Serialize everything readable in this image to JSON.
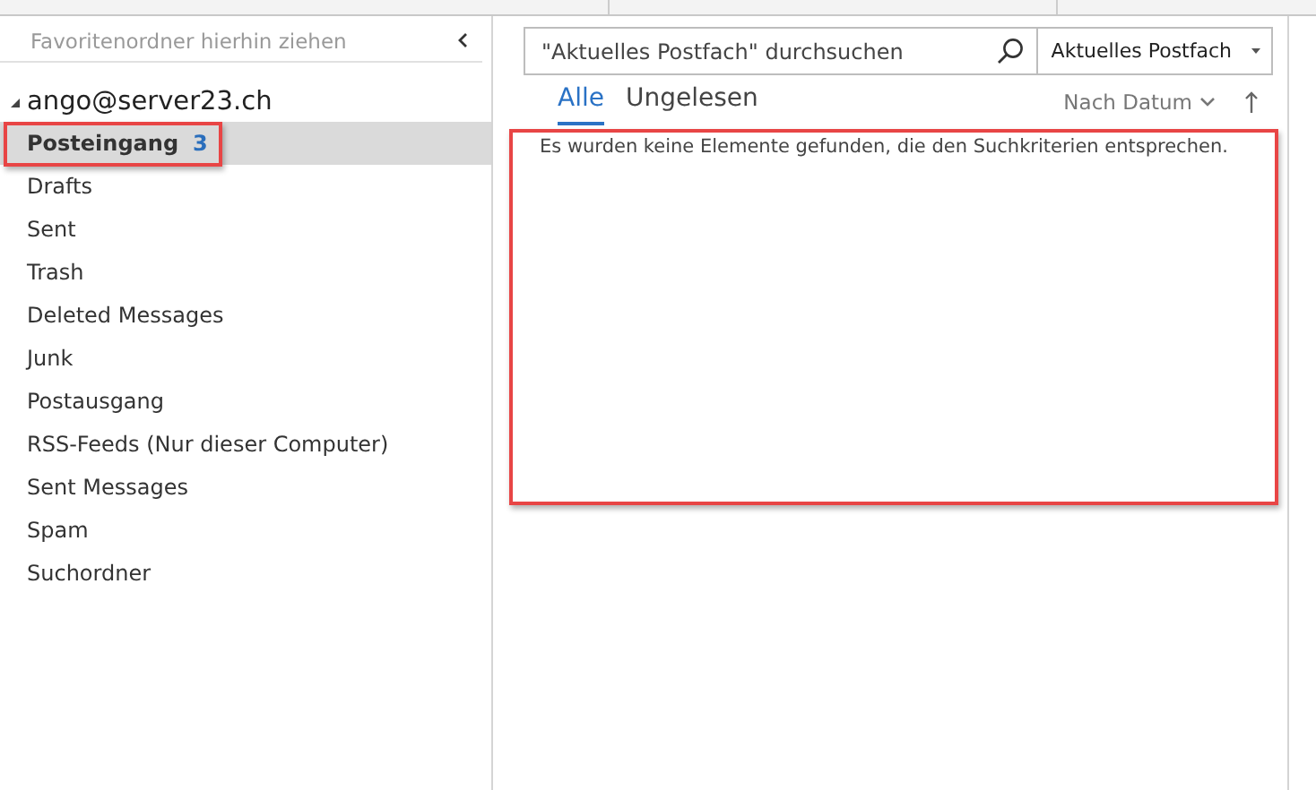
{
  "favorites": {
    "hint": "Favoritenordner hierhin ziehen"
  },
  "account": {
    "name": "ango@server23.ch",
    "expanded": true
  },
  "folders": [
    {
      "name": "Posteingang",
      "count": "3",
      "selected": true,
      "highlighted": true
    },
    {
      "name": "Drafts",
      "selected": false,
      "highlighted": false
    },
    {
      "name": "Sent",
      "selected": false,
      "highlighted": false
    },
    {
      "name": "Trash",
      "selected": false,
      "highlighted": false
    },
    {
      "name": "Deleted Messages",
      "selected": false,
      "highlighted": false
    },
    {
      "name": "Junk",
      "selected": false,
      "highlighted": false
    },
    {
      "name": "Postausgang",
      "selected": false,
      "highlighted": false
    },
    {
      "name": "RSS-Feeds (Nur dieser Computer)",
      "selected": false,
      "highlighted": false
    },
    {
      "name": "Sent Messages",
      "selected": false,
      "highlighted": false
    },
    {
      "name": "Spam",
      "selected": false,
      "highlighted": false
    },
    {
      "name": "Suchordner",
      "selected": false,
      "highlighted": false
    }
  ],
  "search": {
    "placeholder": "\"Aktuelles Postfach\" durchsuchen",
    "scope": "Aktuelles Postfach"
  },
  "filter_tabs": [
    {
      "label": "Alle",
      "selected": true
    },
    {
      "label": "Ungelesen",
      "selected": false
    }
  ],
  "sort": {
    "label": "Nach Datum"
  },
  "message_list": {
    "empty_text": "Es wurden keine Elemente gefunden, die den Suchkriterien entsprechen.",
    "highlighted": true
  }
}
